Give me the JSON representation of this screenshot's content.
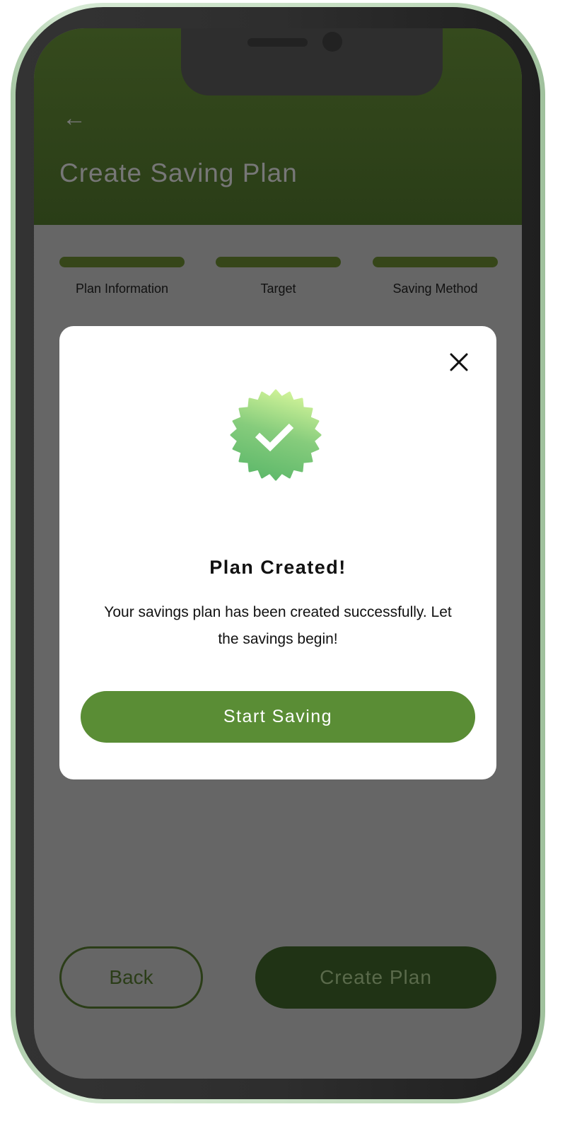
{
  "header": {
    "title": "Create Saving Plan",
    "back_icon": "arrow-left-icon"
  },
  "steps": [
    {
      "label": "Plan Information"
    },
    {
      "label": "Target"
    },
    {
      "label": "Saving Method"
    }
  ],
  "modal": {
    "icon": "verified-badge-check-icon",
    "close_icon": "close-icon",
    "title": "Plan Created!",
    "message": "Your savings plan has been created successfully. Let the savings begin!",
    "button": "Start Saving"
  },
  "footer": {
    "back": "Back",
    "create": "Create Plan"
  },
  "colors": {
    "header": "#354a1d",
    "accent": "#5a8d35",
    "dark_button": "#203315",
    "badge_top": "#d4f59a",
    "badge_bottom": "#5fb96b"
  }
}
